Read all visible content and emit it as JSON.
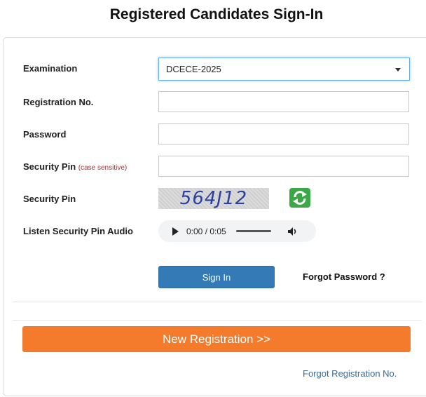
{
  "page": {
    "title": "Registered Candidates Sign-In"
  },
  "form": {
    "examination": {
      "label": "Examination",
      "selected": "DCECE-2025"
    },
    "registration": {
      "label": "Registration No.",
      "value": ""
    },
    "password": {
      "label": "Password",
      "value": ""
    },
    "security_pin_input": {
      "label": "Security Pin",
      "hint": "(case sensitive)",
      "value": ""
    },
    "security_pin_captcha": {
      "label": "Security Pin",
      "code": "564J12"
    },
    "audio": {
      "label": "Listen Security Pin Audio",
      "time": "0:00 / 0:05"
    },
    "signin_label": "Sign In",
    "forgot_password": "Forgot Password ?"
  },
  "footer": {
    "new_registration": "New Registration >>",
    "forgot_registration": "Forgot Registration No."
  },
  "colors": {
    "primary": "#337ab7",
    "accent": "#f47b2b",
    "link": "#3a6b9a",
    "refresh": "#3aa847"
  },
  "icons": {
    "refresh": "refresh-icon",
    "play": "play-icon",
    "volume": "volume-icon",
    "dropdown": "chevron-down-icon"
  }
}
